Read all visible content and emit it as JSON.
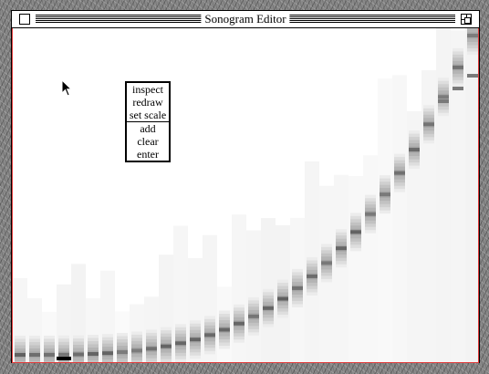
{
  "window": {
    "title": "Sonogram Editor"
  },
  "menu": {
    "items": [
      "inspect",
      "redraw",
      "set scale",
      "add",
      "clear",
      "enter"
    ]
  },
  "icons": {
    "close": "close-box-icon",
    "zoom": "zoom-box-icon",
    "pointer": "arrow-cursor-icon"
  },
  "colors": {
    "window_content_border": "#e23a3a",
    "desktop": "#8a8a8a"
  }
}
